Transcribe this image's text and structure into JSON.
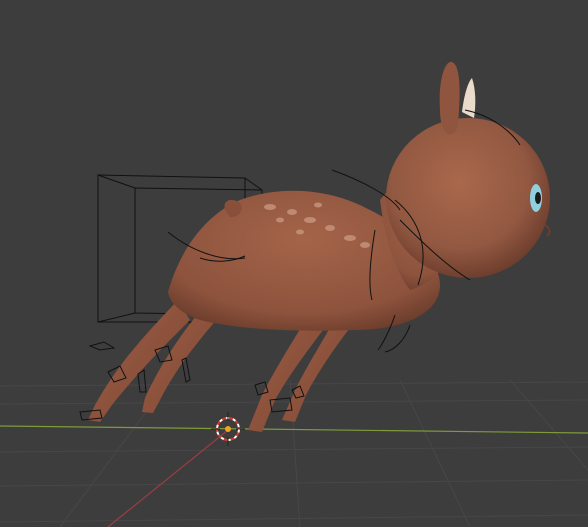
{
  "viewport": {
    "background_color": "#3d3d3d",
    "grid_color": "#474747",
    "x_axis_color": "#7e9a3c",
    "y_axis_color": "#9a3c46"
  },
  "scene": {
    "model_color": "#9b5f45",
    "model_shadow_color": "#7a4634",
    "spot_color": "#c8967e",
    "antler_color": "#e9dccb",
    "eye_color": "#8fd0e0",
    "wire_color": "#111111",
    "cursor_red": "#d83a2a"
  },
  "icons": {
    "camera": "camera-frustum-icon",
    "cursor": "3d-cursor-icon",
    "bones": "bone-control-icon"
  }
}
